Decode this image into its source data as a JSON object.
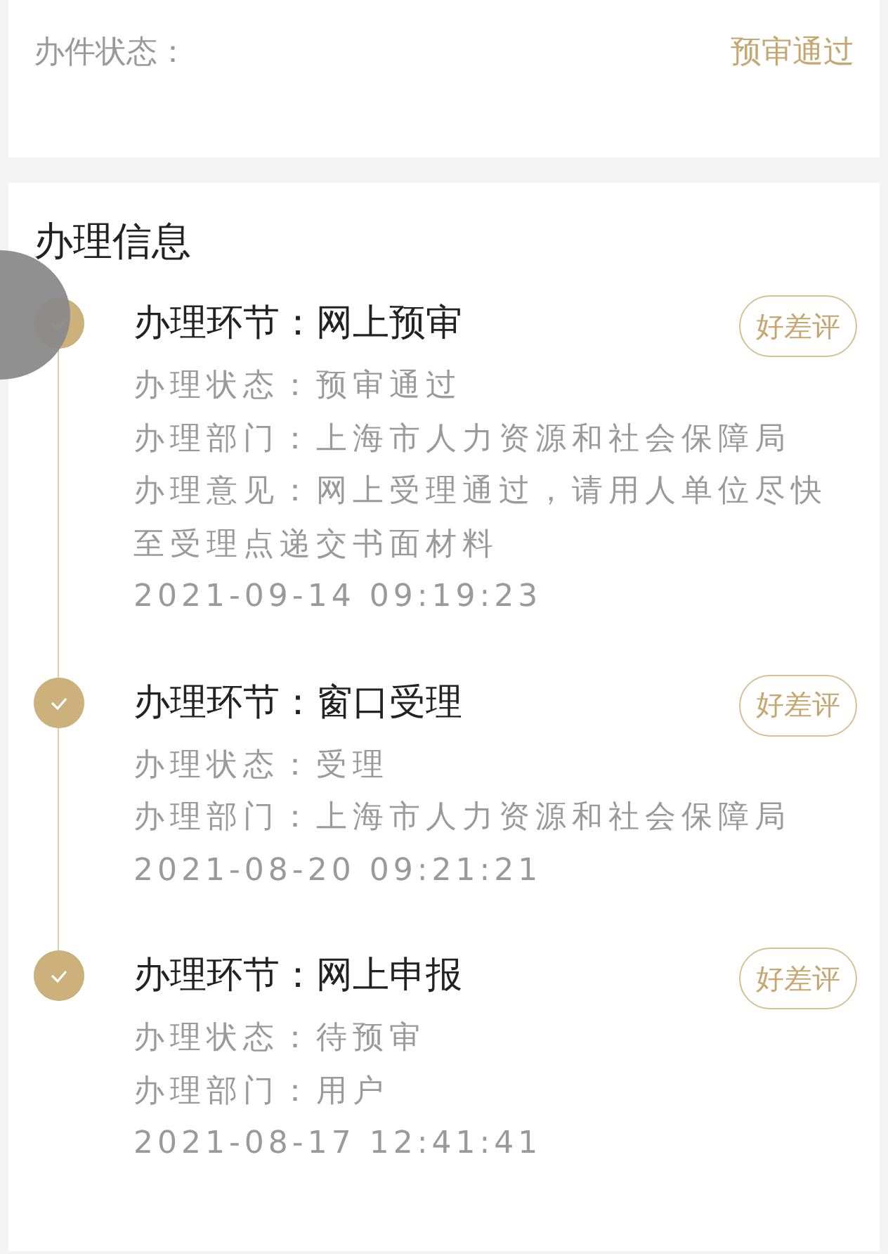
{
  "status_card": {
    "label": "办件状态：",
    "value": "预审通过"
  },
  "progress": {
    "title": "办理信息",
    "items": [
      {
        "step": "办理环节：网上预审",
        "details": [
          "办理状态：预审通过",
          "办理部门：上海市人力资源和社会保障局",
          "办理意见：网上受理通过，请用人单位尽快至受理点递交书面材料"
        ],
        "time": "2021-09-14 09:19:23",
        "rate_button": "好差评"
      },
      {
        "step": "办理环节：窗口受理",
        "details": [
          "办理状态：受理",
          "办理部门：上海市人力资源和社会保障局"
        ],
        "time": "2021-08-20 09:21:21",
        "rate_button": "好差评"
      },
      {
        "step": "办理环节：网上申报",
        "details": [
          "办理状态：待预审",
          "办理部门：用户"
        ],
        "time": "2021-08-17 12:41:41",
        "rate_button": "好差评"
      }
    ]
  }
}
